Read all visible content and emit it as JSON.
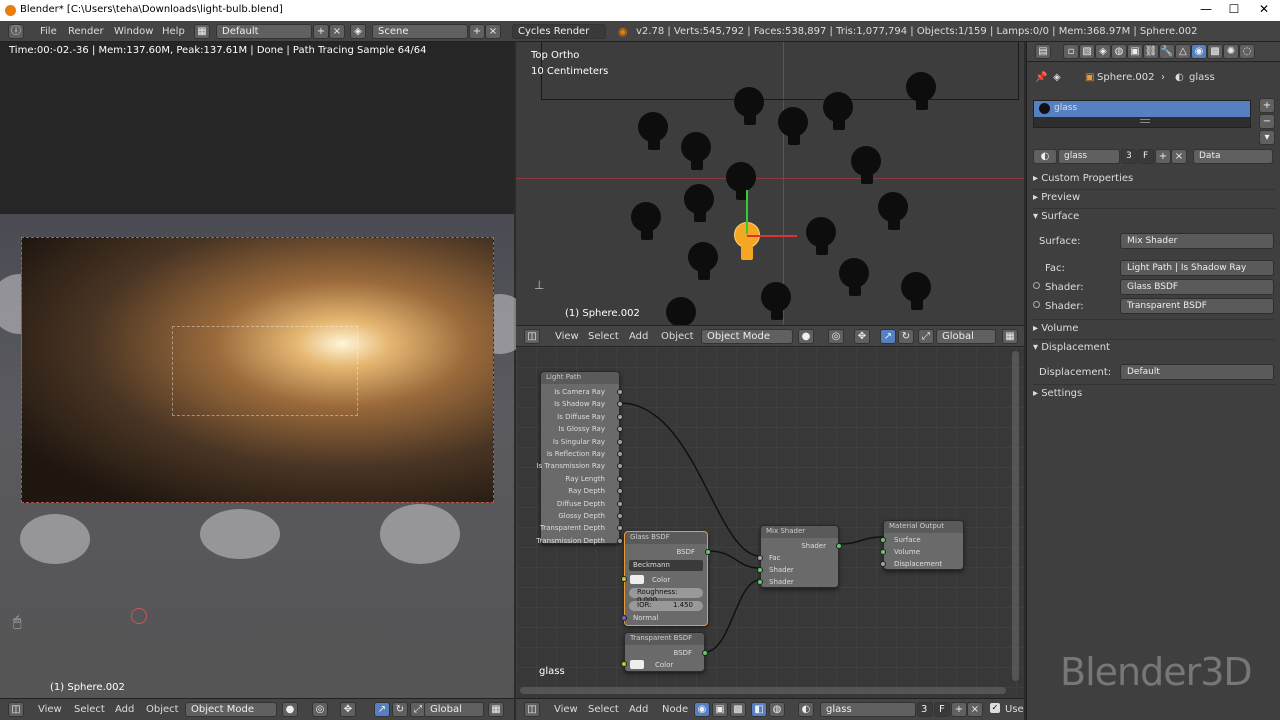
{
  "titlebar": {
    "title": "Blender* [C:\\Users\\teha\\Downloads\\light-bulb.blend]"
  },
  "menubar": {
    "items": [
      "File",
      "Render",
      "Window",
      "Help"
    ],
    "layout": "Default",
    "scene": "Scene",
    "engine": "Cycles Render",
    "stats": "v2.78 | Verts:545,792 | Faces:538,897 | Tris:1,077,794 | Objects:1/159 | Lamps:0/0 | Mem:368.97M | Sphere.002"
  },
  "viewport_left": {
    "render_status": "Time:00:-02.-36 | Mem:137.60M, Peak:137.61M | Done | Path Tracing Sample 64/64",
    "object_label": "(1) Sphere.002",
    "header": {
      "view": "View",
      "select": "Select",
      "add": "Add",
      "object": "Object",
      "mode": "Object Mode",
      "orientation": "Global"
    }
  },
  "viewport_top": {
    "view_name": "Top Ortho",
    "scale": "10 Centimeters",
    "object_label": "(1) Sphere.002",
    "header": {
      "view": "View",
      "select": "Select",
      "add": "Add",
      "object": "Object",
      "mode": "Object Mode",
      "orientation": "Global"
    }
  },
  "node_editor": {
    "material_label": "glass",
    "header": {
      "view": "View",
      "select": "Select",
      "add": "Add",
      "node": "Node",
      "material": "glass",
      "users": "3",
      "f": "F",
      "use": "Use"
    },
    "light_path": {
      "title": "Light Path",
      "outputs": [
        "Is Camera Ray",
        "Is Shadow Ray",
        "Is Diffuse Ray",
        "Is Glossy Ray",
        "Is Singular Ray",
        "Is Reflection Ray",
        "Is Transmission Ray",
        "Ray Length",
        "Ray Depth",
        "Diffuse Depth",
        "Glossy Depth",
        "Transparent Depth",
        "Transmission Depth"
      ]
    },
    "glass_bsdf": {
      "title": "Glass BSDF",
      "output": "BSDF",
      "distribution": "Beckmann",
      "color_label": "Color",
      "roughness": "Roughness: 0.000",
      "ior_label": "IOR:",
      "ior_value": "1.450",
      "normal": "Normal"
    },
    "transparent_bsdf": {
      "title": "Transparent BSDF",
      "output": "BSDF",
      "color_label": "Color"
    },
    "mix_shader": {
      "title": "Mix Shader",
      "output": "Shader",
      "inputs": [
        "Fac",
        "Shader",
        "Shader"
      ]
    },
    "material_output": {
      "title": "Material Output",
      "inputs": [
        "Surface",
        "Volume",
        "Displacement"
      ]
    }
  },
  "properties": {
    "breadcrumb": {
      "object": "Sphere.002",
      "material": "glass"
    },
    "slot": "glass",
    "material_field": "glass",
    "users": "3",
    "f": "F",
    "link": "Data",
    "panels": {
      "custom": "Custom Properties",
      "preview": "Preview",
      "surface": "Surface",
      "volume": "Volume",
      "displacement": "Displacement",
      "settings": "Settings"
    },
    "surface": {
      "surface_label": "Surface:",
      "surface_value": "Mix Shader",
      "fac_label": "Fac:",
      "fac_value": "Light Path | Is Shadow Ray",
      "shader1_label": "Shader:",
      "shader1_value": "Glass BSDF",
      "shader2_label": "Shader:",
      "shader2_value": "Transparent BSDF"
    },
    "displacement": {
      "label": "Displacement:",
      "value": "Default"
    }
  },
  "watermark": "Blender3D"
}
